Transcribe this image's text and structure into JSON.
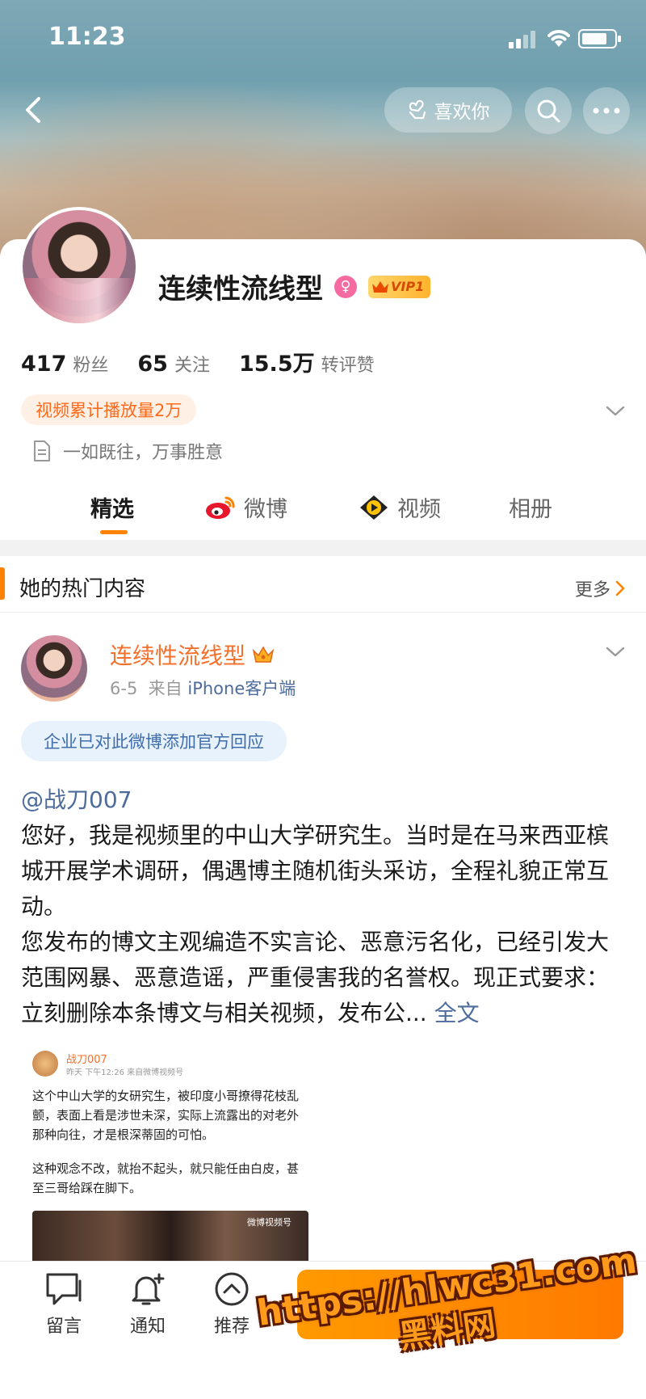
{
  "status_bar": {
    "time": "11:23"
  },
  "header": {
    "like_label": "喜欢你"
  },
  "profile": {
    "name": "连续性流线型",
    "gender_symbol": "♀",
    "vip_label": "VIP1",
    "stats": [
      {
        "num": "417",
        "label": "粉丝"
      },
      {
        "num": "65",
        "label": "关注"
      },
      {
        "num": "15.5万",
        "label": "转评赞"
      }
    ],
    "play_badge": "视频累计播放量2万",
    "bio": "一如既往，万事胜意"
  },
  "tabs": [
    {
      "label": "精选"
    },
    {
      "label": "微博"
    },
    {
      "label": "视频"
    },
    {
      "label": "相册"
    }
  ],
  "hot": {
    "title": "她的热门内容",
    "more": "更多"
  },
  "post": {
    "author": "连续性流线型",
    "date": "6-5",
    "source_prefix": "来自",
    "source": "iPhone客户端",
    "official_reply": "企业已对此微博添加官方回应",
    "mention": "@战刀007",
    "paragraph1": "您好，我是视频里的中山大学研究生。当时是在马来西亚槟城开展学术调研，偶遇博主随机街头采访，全程礼貌正常互动。",
    "paragraph2": "您发布的博文主观编造不实言论、恶意污名化，已经引发大范围网暴、恶意造谣，严重侵害我的名誉权。现正式要求：立刻删除本条博文与相关视频，发布公...",
    "full_text_link": "全文"
  },
  "embed": {
    "name": "战刀007",
    "meta": "昨天 下午12:26  来自微博视频号",
    "text1": "这个中山大学的女研究生，被印度小哥撩得花枝乱颤，表面上看是涉世未深，实际上流露出的对老外那种向往，才是根深蒂固的可怕。",
    "text2": "这种观念不改，就抬不起头，就只能任由白皮，甚至三哥给踩在脚下。",
    "watermark": "微博视频号"
  },
  "bottom_bar": {
    "items": [
      {
        "label": "留言"
      },
      {
        "label": "通知"
      },
      {
        "label": "推荐"
      }
    ]
  },
  "overlay_watermark": {
    "url": "https://hlwc31.com",
    "cn": "黑料网"
  },
  "colors": {
    "accent": "#ff8200",
    "link": "#4d6c9c",
    "name_orange": "#f3702d"
  }
}
